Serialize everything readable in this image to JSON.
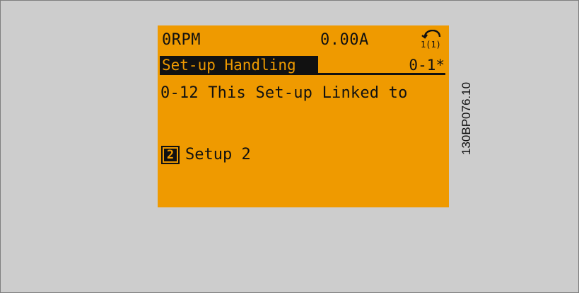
{
  "lcd": {
    "status_bar": {
      "speed": "0RPM",
      "current": "0.00A",
      "setup_icon": "set-up-icon",
      "setup_icon_text": "1(1)"
    },
    "menu": {
      "group_title": "Set-up Handling",
      "index": "0-1*"
    },
    "parameter": {
      "title": "0-12 This Set-up Linked to"
    },
    "option": {
      "selected_number": "2",
      "label": "Setup 2"
    }
  },
  "figure_code": "130BP076.10",
  "colors": {
    "background": "#cdcdcd",
    "lcd_background": "#ef9a00",
    "lcd_text": "#111111"
  }
}
